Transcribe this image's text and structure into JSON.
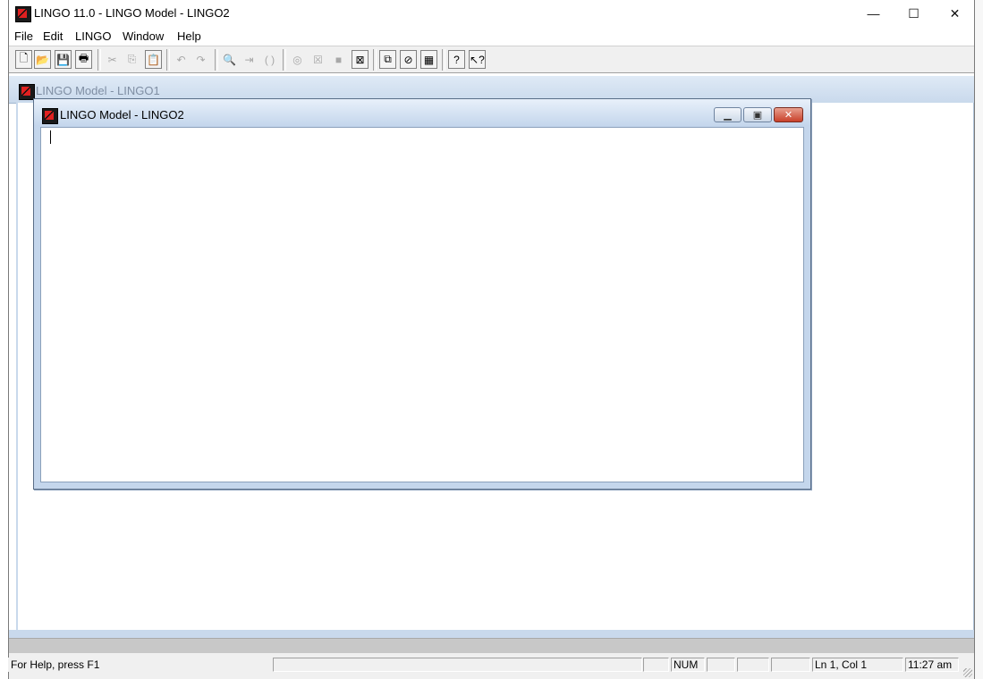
{
  "window": {
    "title": "LINGO 11.0 - LINGO Model - LINGO2",
    "minimize_glyph": "—",
    "maximize_glyph": "☐",
    "close_glyph": "✕"
  },
  "menu": [
    "File",
    "Edit",
    "LINGO",
    "Window",
    "Help"
  ],
  "toolbar": {
    "icons": [
      "new-icon",
      "open-icon",
      "save-icon",
      "print-icon",
      "cut-icon",
      "copy-icon",
      "paste-icon",
      "undo-icon",
      "redo-icon",
      "find-icon",
      "goto-line-icon",
      "match-paren-icon",
      "solve-icon",
      "solution-icon",
      "stop-icon",
      "close-all-icon",
      "tile-icon",
      "send-to-back-icon",
      "options-icon",
      "help-topics-icon",
      "context-help-icon"
    ]
  },
  "mdi": {
    "background_window_title": "LINGO Model - LINGO1",
    "active_window_title": "LINGO Model - LINGO2",
    "editor_text": ""
  },
  "status": {
    "help_text": "For Help, press F1",
    "num": "NUM",
    "position": "Ln 1, Col 1",
    "time": "11:27 am"
  },
  "colors": {
    "brand_red": "#e02020",
    "mdi_title": "#c4d6ec",
    "close_red": "#c9402a"
  }
}
